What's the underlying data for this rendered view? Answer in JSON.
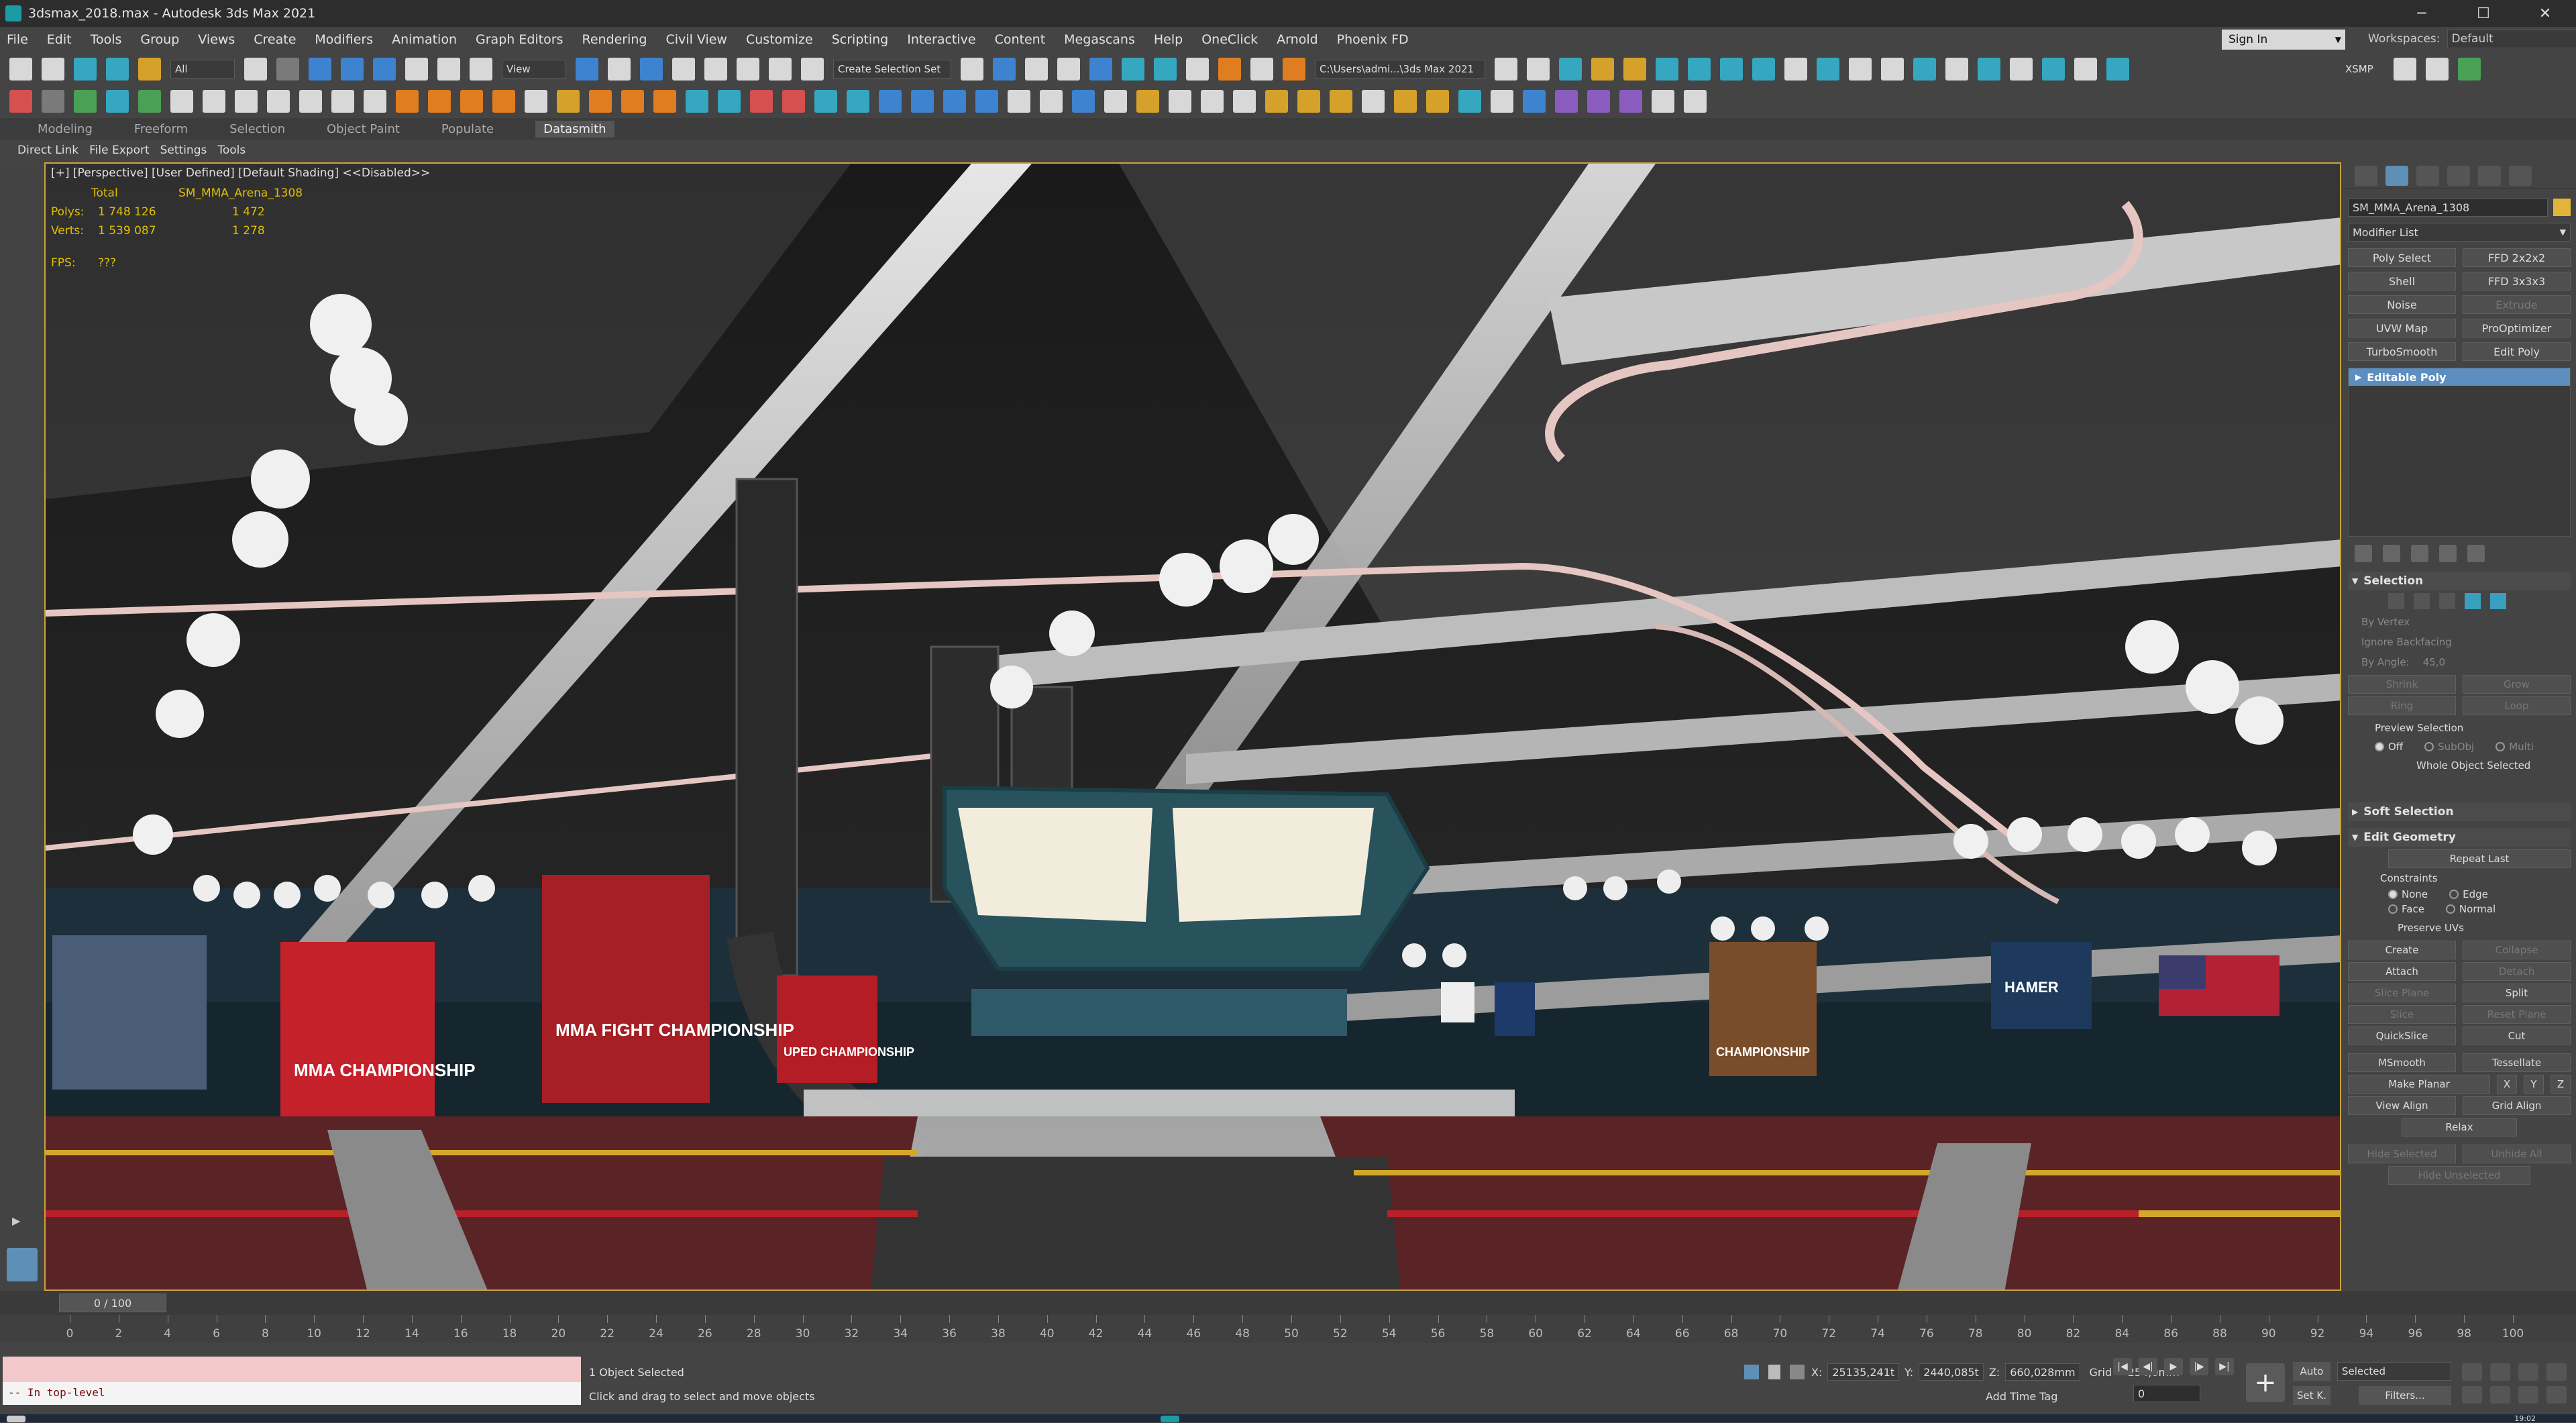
{
  "window": {
    "title": "3dsmax_2018.max - Autodesk 3ds Max 2021",
    "minimize": "─",
    "maximize": "☐",
    "close": "✕"
  },
  "menu": [
    "File",
    "Edit",
    "Tools",
    "Group",
    "Views",
    "Create",
    "Modifiers",
    "Animation",
    "Graph Editors",
    "Rendering",
    "Civil View",
    "Customize",
    "Scripting",
    "Interactive",
    "Content",
    "Megascans",
    "Help",
    "OneClick",
    "Arnold",
    "Phoenix FD"
  ],
  "account": {
    "signin": "Sign In",
    "workspaces_label": "Workspaces:",
    "workspace": "Default"
  },
  "toolbar": {
    "filter": "All",
    "refcoord": "View",
    "selset": "Create Selection Set",
    "path": "C:\\Users\\admi...\\3ds Max 2021",
    "xsmp": "XSMP"
  },
  "ribbon": {
    "tabs": [
      "Modeling",
      "Freeform",
      "Selection",
      "Object Paint",
      "Populate",
      "Datasmith"
    ],
    "active": "Datasmith",
    "subtabs": [
      "Direct Link",
      "File Export",
      "Settings",
      "Tools"
    ]
  },
  "viewport": {
    "label": "[+] [Perspective] [User Defined] [Default Shading] <<Disabled>>",
    "stats": {
      "total_label": "Total",
      "obj_label": "SM_MMA_Arena_1308",
      "polys_label": "Polys:",
      "polys_total": "1 748 126",
      "polys_sel": "1 472",
      "verts_label": "Verts:",
      "verts_total": "1 539 087",
      "verts_sel": "1 278",
      "fps_label": "FPS:",
      "fps": "???"
    },
    "posters": [
      "MMA FIGHT CHAMPIONSHIP",
      "MMA CHAMPIONSHIP",
      "CHAMPIONSHIP",
      "UPED CHAMPIONSHIP",
      "HAMER"
    ]
  },
  "command_panel": {
    "object_name": "SM_MMA_Arena_1308",
    "modifier_list": "Modifier List",
    "modifiers": [
      {
        "l": "Poly Select",
        "d": false
      },
      {
        "l": "FFD 2x2x2",
        "d": false
      },
      {
        "l": "Shell",
        "d": false
      },
      {
        "l": "FFD 3x3x3",
        "d": false
      },
      {
        "l": "Noise",
        "d": false
      },
      {
        "l": "Extrude",
        "d": true
      },
      {
        "l": "UVW Map",
        "d": false
      },
      {
        "l": "ProOptimizer",
        "d": false
      },
      {
        "l": "TurboSmooth",
        "d": false
      },
      {
        "l": "Edit Poly",
        "d": false
      }
    ],
    "stack_item": "Editable Poly",
    "selection": {
      "title": "Selection",
      "by_vertex": "By Vertex",
      "ignore_backfacing": "Ignore Backfacing",
      "by_angle": "By Angle:",
      "angle": "45,0",
      "shrink": "Shrink",
      "grow": "Grow",
      "ring": "Ring",
      "loop": "Loop",
      "preview": "Preview Selection",
      "off": "Off",
      "subobj": "SubObj",
      "multi": "Multi",
      "whole": "Whole Object Selected"
    },
    "soft_selection": "Soft Selection",
    "edit_geometry": {
      "title": "Edit Geometry",
      "repeat_last": "Repeat Last",
      "constraints": "Constraints",
      "none": "None",
      "edge": "Edge",
      "face": "Face",
      "normal": "Normal",
      "preserve_uvs": "Preserve UVs",
      "create": "Create",
      "collapse": "Collapse",
      "attach": "Attach",
      "detach": "Detach",
      "slice_plane": "Slice Plane",
      "split": "Split",
      "slice": "Slice",
      "reset_plane": "Reset Plane",
      "quickslice": "QuickSlice",
      "cut": "Cut",
      "msmooth": "MSmooth",
      "tessellate": "Tessellate",
      "make_planar": "Make Planar",
      "x": "X",
      "y": "Y",
      "z": "Z",
      "view_align": "View Align",
      "grid_align": "Grid Align",
      "relax": "Relax",
      "hide_selected": "Hide Selected",
      "unhide_all": "Unhide All",
      "hide_unselected": "Hide Unselected"
    }
  },
  "timeline": {
    "slider": "0 / 100",
    "ticks": [
      "0",
      "2",
      "4",
      "6",
      "8",
      "10",
      "12",
      "14",
      "16",
      "18",
      "20",
      "22",
      "24",
      "26",
      "28",
      "30",
      "32",
      "34",
      "36",
      "38",
      "40",
      "42",
      "44",
      "46",
      "48",
      "50",
      "52",
      "54",
      "56",
      "58",
      "60",
      "62",
      "64",
      "66",
      "68",
      "70",
      "72",
      "74",
      "76",
      "78",
      "80",
      "82",
      "84",
      "86",
      "88",
      "90",
      "92",
      "94",
      "96",
      "98",
      "100"
    ]
  },
  "status": {
    "maxscript": "-- In top-level",
    "selected": "1 Object Selected",
    "hint": "Click and drag to select and move objects",
    "x_label": "X:",
    "x": "25135,241t",
    "y_label": "Y:",
    "y": "2440,085t",
    "z_label": "Z:",
    "z": "660,028mm",
    "grid": "Grid = 254,0mm",
    "add_time_tag": "Add Time Tag",
    "auto": "Auto",
    "setk": "Set K.",
    "selected_combo": "Selected",
    "filters": "Filters...",
    "frame": "0",
    "clock": "19:02"
  }
}
